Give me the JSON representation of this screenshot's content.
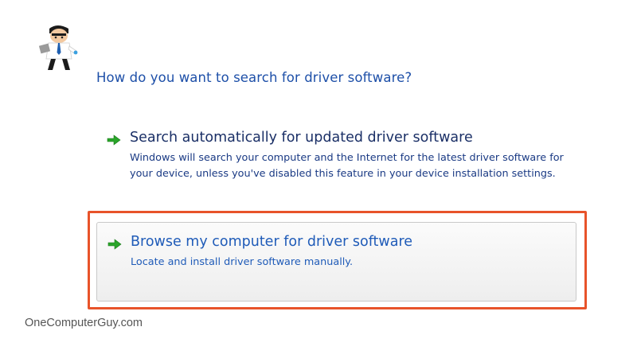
{
  "logo": {
    "icon": "computer-guy-mascot-icon"
  },
  "dialog": {
    "question": "How do you want to search for driver software?",
    "options": [
      {
        "icon": "green-arrow-icon",
        "title": "Search automatically for updated driver software",
        "description": "Windows will search your computer and the Internet for the latest driver software for your device, unless you've disabled this feature in your device installation settings."
      },
      {
        "icon": "green-arrow-icon",
        "title": "Browse my computer for driver software",
        "description": "Locate and install driver software manually."
      }
    ]
  },
  "highlight": {
    "color": "#e8532a"
  },
  "watermark": "OneComputerGuy.com",
  "colors": {
    "link_blue": "#1f5bb8",
    "arrow_green": "#2aa52a"
  }
}
